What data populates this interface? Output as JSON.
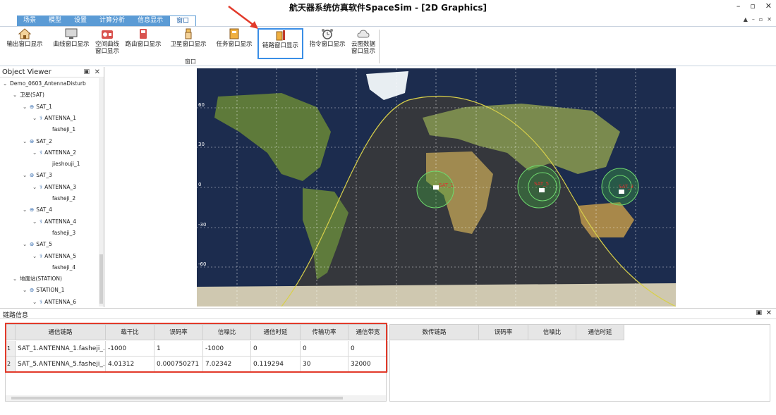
{
  "window": {
    "title": "航天器系统仿真软件SpaceSim - [2D Graphics]",
    "controls": [
      "–",
      "▫",
      "✕"
    ]
  },
  "menu": {
    "tabs": [
      "场景",
      "模型",
      "设置",
      "计算分析",
      "信息显示",
      "窗口"
    ],
    "active_tab": "窗口",
    "right_controls": [
      "▲",
      "–",
      "▫",
      "✕"
    ]
  },
  "ribbon": {
    "group_label": "窗口",
    "buttons": [
      {
        "label": "输出窗口显示",
        "icon": "home-icon"
      },
      {
        "label": "曲线窗口显示",
        "icon": "monitor-icon"
      },
      {
        "label": "空间曲线\n窗口显示",
        "icon": "radio-icon"
      },
      {
        "label": "路由窗口显示",
        "icon": "device-icon"
      },
      {
        "label": "卫星窗口显示",
        "icon": "usb-icon"
      },
      {
        "label": "任务窗口显示",
        "icon": "book-icon"
      },
      {
        "label": "链路窗口显示",
        "icon": "tools-icon"
      },
      {
        "label": "指令窗口显示",
        "icon": "alarm-clock-icon"
      },
      {
        "label": "云图数据\n窗口显示",
        "icon": "cloud-icon"
      }
    ]
  },
  "object_viewer": {
    "title": "Object Viewer",
    "tree": [
      {
        "label": "Demo_0603_AntennaDisturb",
        "level": 0
      },
      {
        "label": "卫星(SAT)",
        "level": 1
      },
      {
        "label": "SAT_1",
        "level": 2
      },
      {
        "label": "ANTENNA_1",
        "level": 3
      },
      {
        "label": "fasheji_1",
        "level": 4
      },
      {
        "label": "SAT_2",
        "level": 2
      },
      {
        "label": "ANTENNA_2",
        "level": 3
      },
      {
        "label": "jieshouji_1",
        "level": 4
      },
      {
        "label": "SAT_3",
        "level": 2
      },
      {
        "label": "ANTENNA_3",
        "level": 3
      },
      {
        "label": "fasheji_2",
        "level": 4
      },
      {
        "label": "SAT_4",
        "level": 2
      },
      {
        "label": "ANTENNA_4",
        "level": 3
      },
      {
        "label": "fasheji_3",
        "level": 4
      },
      {
        "label": "SAT_5",
        "level": 2
      },
      {
        "label": "ANTENNA_5",
        "level": 3
      },
      {
        "label": "fasheji_4",
        "level": 4
      },
      {
        "label": "地面站(STATION)",
        "level": 1
      },
      {
        "label": "STATION_1",
        "level": 2
      },
      {
        "label": "ANTENNA_6",
        "level": 3
      }
    ]
  },
  "map": {
    "lat_labels": [
      "60",
      "30",
      "0",
      "-30",
      "-60"
    ],
    "sat_labels": [
      "SAT_1",
      "SAT_5",
      "SAT_3"
    ]
  },
  "link_panel": {
    "title": "链路信息",
    "columns": [
      "通信链路",
      "载干比",
      "误码率",
      "信噪比",
      "通信时延",
      "传输功率",
      "通信带宽"
    ],
    "rows": [
      [
        "SAT_1.ANTENNA_1.fasheji_...",
        "-1000",
        "1",
        "-1000",
        "0",
        "0",
        "0"
      ],
      [
        "SAT_5.ANTENNA_5.fasheji_...",
        "4.01312",
        "0.000750271",
        "7.02342",
        "0.119294",
        "30",
        "32000"
      ]
    ],
    "row_numbers": [
      "1",
      "2"
    ],
    "data_columns": [
      "数传链路",
      "误码率",
      "信噪比",
      "通信时延"
    ]
  }
}
